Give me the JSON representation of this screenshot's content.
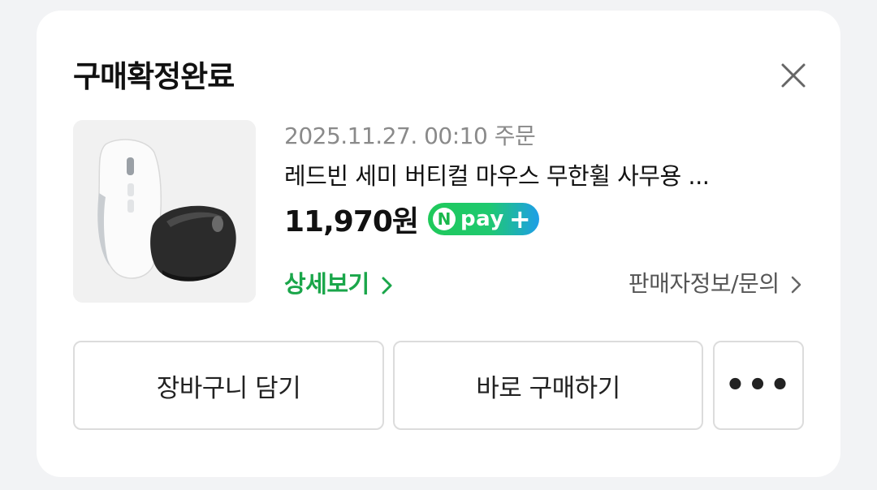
{
  "header": {
    "title": "구매확정완료"
  },
  "order": {
    "date_text": "2025.11.27. 00:10 주문",
    "product_name": "레드빈 세미 버티컬 마우스 무한휠 사무용 ...",
    "price": "11,970원",
    "npay": {
      "n": "N",
      "pay": "pay",
      "plus": "+"
    },
    "detail_link": "상세보기",
    "seller_link": "판매자정보/문의"
  },
  "actions": {
    "cart_label": "장바구니 담기",
    "buy_label": "바로 구매하기",
    "more_label": "•••"
  },
  "colors": {
    "accent_green": "#1aa64a",
    "npay_start": "#1fc95a",
    "npay_end": "#1e9ee8"
  },
  "icons": {
    "close": "close-icon",
    "chevron": "chevron-right-icon",
    "more": "more-icon"
  }
}
